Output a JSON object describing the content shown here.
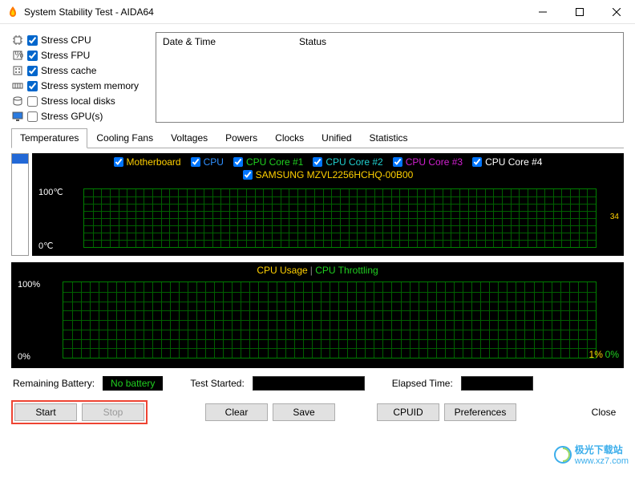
{
  "window": {
    "title": "System Stability Test - AIDA64"
  },
  "stress": {
    "cpu": "Stress CPU",
    "fpu": "Stress FPU",
    "cache": "Stress cache",
    "mem": "Stress system memory",
    "disk": "Stress local disks",
    "gpu": "Stress GPU(s)"
  },
  "log": {
    "col_datetime": "Date & Time",
    "col_status": "Status"
  },
  "tabs": {
    "temperatures": "Temperatures",
    "fans": "Cooling Fans",
    "voltages": "Voltages",
    "powers": "Powers",
    "clocks": "Clocks",
    "unified": "Unified",
    "statistics": "Statistics"
  },
  "temp_legend": {
    "mb": "Motherboard",
    "cpu": "CPU",
    "core1": "CPU Core #1",
    "core2": "CPU Core #2",
    "core3": "CPU Core #3",
    "core4": "CPU Core #4",
    "ssd": "SAMSUNG MZVL2256HCHQ-00B00",
    "ytop": "100℃",
    "ybot": "0℃",
    "rval": "34"
  },
  "usage_legend": {
    "l1": "CPU Usage",
    "l2": "CPU Throttling",
    "ytop": "100%",
    "ybot": "0%",
    "rval1": "1%",
    "rval2": "0%"
  },
  "status": {
    "batt_label": "Remaining Battery:",
    "batt_value": "No battery",
    "started_label": "Test Started:",
    "elapsed_label": "Elapsed Time:"
  },
  "buttons": {
    "start": "Start",
    "stop": "Stop",
    "clear": "Clear",
    "save": "Save",
    "cpuid": "CPUID",
    "prefs": "Preferences",
    "close": "Close"
  },
  "watermark": {
    "text": "极光下载站",
    "url": "www.xz7.com"
  },
  "chart_data": [
    {
      "type": "line",
      "title": "Temperatures",
      "ylabel": "°C",
      "ylim": [
        0,
        100
      ],
      "series": [
        {
          "name": "Motherboard",
          "color": "#ffd000",
          "values": []
        },
        {
          "name": "CPU",
          "color": "#3090ff",
          "values": []
        },
        {
          "name": "CPU Core #1",
          "color": "#20d020",
          "values": []
        },
        {
          "name": "CPU Core #2",
          "color": "#20d0d0",
          "values": []
        },
        {
          "name": "CPU Core #3",
          "color": "#d020d0",
          "values": []
        },
        {
          "name": "CPU Core #4",
          "color": "#ffffff",
          "values": []
        },
        {
          "name": "SAMSUNG MZVL2256HCHQ-00B00",
          "color": "#ffd000",
          "values": []
        }
      ],
      "current_value": 34
    },
    {
      "type": "line",
      "title": "CPU Usage / CPU Throttling",
      "ylabel": "%",
      "ylim": [
        0,
        100
      ],
      "series": [
        {
          "name": "CPU Usage",
          "color": "#ffd000",
          "values": []
        },
        {
          "name": "CPU Throttling",
          "color": "#20d020",
          "values": []
        }
      ],
      "current_values": [
        1,
        0
      ]
    }
  ]
}
